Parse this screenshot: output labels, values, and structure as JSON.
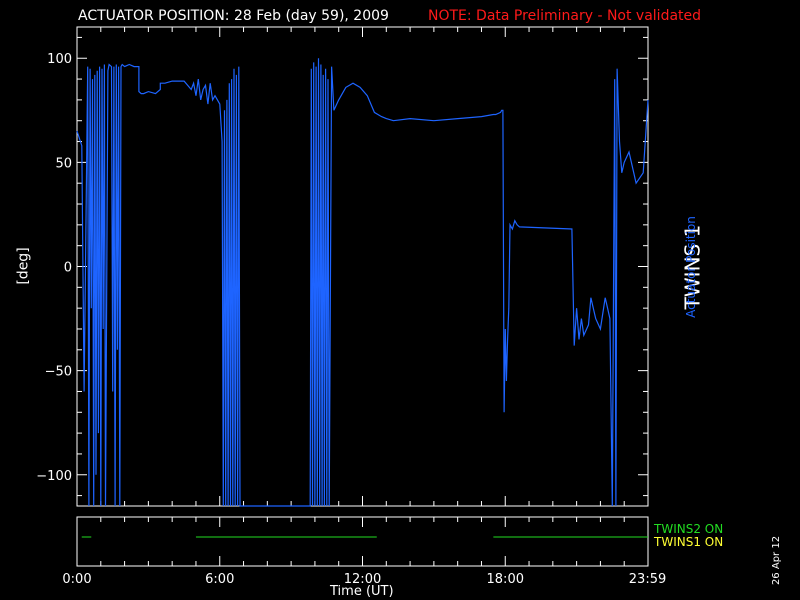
{
  "header": {
    "title": "ACTUATOR POSITION: 28 Feb (day  59), 2009",
    "note": "NOTE: Data Preliminary - Not validated"
  },
  "right_labels": {
    "spacecraft": "TWINS 1",
    "series": "Actuator Position"
  },
  "status_legend": {
    "twins2": "TWINS2 ON",
    "twins1": "TWINS1 ON"
  },
  "footer": {
    "date_stamp": "26 Apr 12"
  },
  "colors": {
    "series": "#1e64ff",
    "note": "#ff1a1a",
    "twins2": "#22dd22",
    "twins1": "#ffff33"
  },
  "chart_data": {
    "type": "line",
    "title": "ACTUATOR POSITION: 28 Feb (day  59), 2009",
    "xlabel": "Time (UT)",
    "ylabel": "[deg]",
    "xlim": [
      0,
      24
    ],
    "ylim": [
      -115,
      115
    ],
    "x_ticks": [
      0,
      6,
      12,
      18,
      23.98
    ],
    "x_tick_labels": [
      "0:00",
      "6:00",
      "12:00",
      "18:00",
      "23:59"
    ],
    "y_ticks": [
      -100,
      -50,
      0,
      50,
      100
    ],
    "y_tick_labels": [
      "−100",
      "−50",
      "0",
      "50",
      "100"
    ],
    "series": [
      {
        "name": "Actuator Position",
        "x": [
          0.0,
          0.2,
          0.3,
          0.45,
          0.5,
          0.55,
          0.6,
          0.65,
          0.7,
          0.75,
          0.8,
          0.85,
          0.9,
          0.95,
          1.0,
          1.05,
          1.1,
          1.15,
          1.2,
          1.3,
          1.35,
          1.45,
          1.5,
          1.55,
          1.6,
          1.65,
          1.7,
          1.75,
          1.8,
          1.85,
          1.9,
          2.0,
          2.2,
          2.4,
          2.6,
          2.6,
          2.7,
          2.8,
          3.0,
          3.3,
          3.5,
          3.5,
          3.7,
          4.0,
          4.5,
          4.8,
          4.9,
          5.0,
          5.1,
          5.2,
          5.3,
          5.4,
          5.5,
          5.6,
          5.7,
          5.8,
          6.0,
          6.1,
          6.15,
          6.2,
          6.25,
          6.3,
          6.35,
          6.4,
          6.45,
          6.5,
          6.55,
          6.6,
          6.65,
          6.7,
          6.75,
          6.8,
          6.85,
          6.9,
          7.0,
          8.0,
          9.0,
          9.8,
          9.85,
          9.9,
          9.95,
          10.0,
          10.05,
          10.1,
          10.15,
          10.2,
          10.25,
          10.3,
          10.35,
          10.4,
          10.45,
          10.5,
          10.55,
          10.6,
          10.7,
          10.8,
          11.0,
          11.3,
          11.6,
          11.9,
          12.2,
          12.5,
          12.8,
          13.0,
          13.3,
          14.0,
          15.0,
          16.0,
          17.0,
          17.5,
          17.6,
          17.8,
          17.85,
          17.9,
          17.95,
          18.0,
          18.05,
          18.1,
          18.15,
          18.2,
          18.3,
          18.4,
          18.5,
          18.6,
          20.8,
          20.9,
          21.0,
          21.1,
          21.2,
          21.3,
          21.5,
          21.6,
          21.7,
          21.8,
          22.0,
          22.2,
          22.3,
          22.4,
          22.5,
          22.6,
          22.65,
          22.7,
          22.8,
          22.9,
          23.0,
          23.2,
          23.5,
          23.8,
          24.0
        ],
        "y": [
          65,
          58,
          -60,
          96,
          -115,
          95,
          -20,
          90,
          -115,
          92,
          -100,
          94,
          -80,
          96,
          -115,
          95,
          -30,
          97,
          -115,
          94,
          97,
          96,
          -60,
          96,
          -115,
          97,
          -40,
          96,
          -115,
          96,
          97,
          96,
          97,
          96,
          96,
          84,
          83,
          83,
          84,
          83,
          85,
          88,
          88,
          89,
          89,
          85,
          88,
          82,
          90,
          80,
          85,
          87,
          78,
          88,
          80,
          82,
          78,
          60,
          -115,
          75,
          -115,
          80,
          -115,
          88,
          -115,
          90,
          -115,
          95,
          -115,
          92,
          -115,
          96,
          -115,
          -115,
          -115,
          -115,
          -115,
          -115,
          95,
          -115,
          98,
          -115,
          96,
          -115,
          100,
          -115,
          97,
          -115,
          92,
          -115,
          95,
          -115,
          90,
          -115,
          96,
          75,
          80,
          86,
          88,
          86,
          82,
          74,
          72,
          71,
          70,
          71,
          70,
          71,
          72,
          73,
          73,
          74,
          75,
          75,
          -70,
          -30,
          -55,
          -35,
          -20,
          20,
          18,
          22,
          20,
          19,
          18,
          -38,
          -20,
          -35,
          -25,
          -33,
          -28,
          -15,
          -20,
          -25,
          -30,
          -15,
          -20,
          -25,
          -115,
          90,
          -115,
          95,
          60,
          45,
          50,
          55,
          40,
          45,
          80
        ]
      }
    ],
    "status_panel": {
      "series": [
        {
          "name": "TWINS2 ON",
          "color": "#22dd22",
          "intervals": [
            [
              0.2,
              0.6
            ],
            [
              5.0,
              12.6
            ],
            [
              17.5,
              24.0
            ]
          ]
        },
        {
          "name": "TWINS1 ON",
          "color": "#ffff33",
          "intervals": []
        }
      ]
    }
  }
}
